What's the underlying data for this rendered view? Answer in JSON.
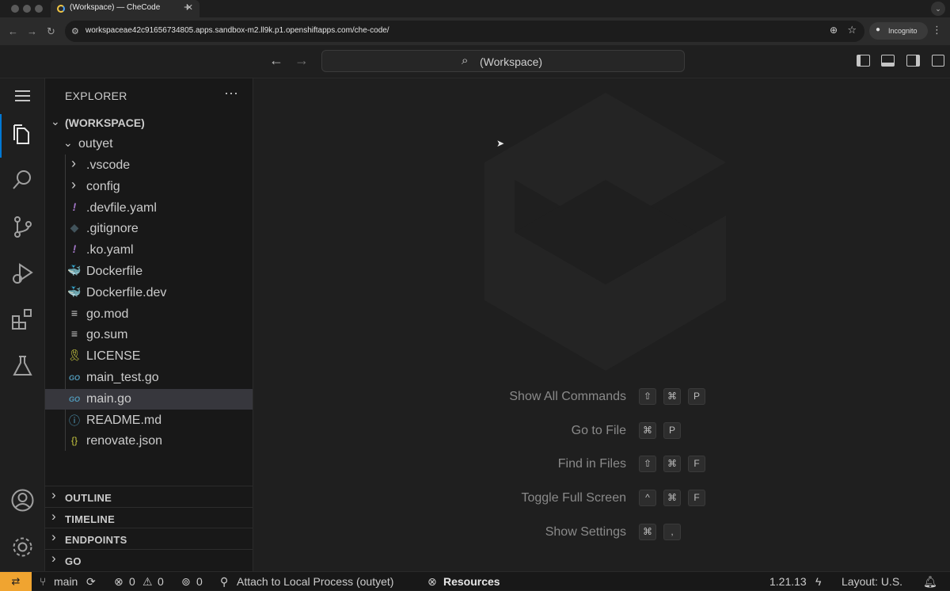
{
  "browser": {
    "tab_title": "(Workspace) — CheCode",
    "tab_close": "✕",
    "new_tab": "+",
    "url": "workspaceae42c91656734805.apps.sandbox-m2.ll9k.p1.openshiftapps.com/che-code/",
    "incognito_label": "Incognito"
  },
  "titlebar": {
    "command_center": "(Workspace)"
  },
  "explorer": {
    "title": "EXPLORER",
    "more": "···",
    "root": "(WORKSPACE)",
    "folder": "outyet",
    "items": [
      {
        "name": ".vscode",
        "type": "folder",
        "icon": "chevron-right-icon"
      },
      {
        "name": "config",
        "type": "folder",
        "icon": "chevron-right-icon"
      },
      {
        "name": ".devfile.yaml",
        "type": "file",
        "icon": "yaml-icon",
        "glyph": "!",
        "color": "#a074c4"
      },
      {
        "name": ".gitignore",
        "type": "file",
        "icon": "git-icon",
        "glyph": "◆",
        "color": "#41535b"
      },
      {
        "name": ".ko.yaml",
        "type": "file",
        "icon": "yaml-icon",
        "glyph": "!",
        "color": "#a074c4"
      },
      {
        "name": "Dockerfile",
        "type": "file",
        "icon": "docker-icon",
        "glyph": "🐳",
        "color": "#519aba"
      },
      {
        "name": "Dockerfile.dev",
        "type": "file",
        "icon": "docker-icon",
        "glyph": "🐳",
        "color": "#519aba"
      },
      {
        "name": "go.mod",
        "type": "file",
        "icon": "lines-icon",
        "glyph": "≡",
        "color": "#cccccc"
      },
      {
        "name": "go.sum",
        "type": "file",
        "icon": "lines-icon",
        "glyph": "≡",
        "color": "#cccccc"
      },
      {
        "name": "LICENSE",
        "type": "file",
        "icon": "license-icon",
        "glyph": "🎗",
        "color": "#cbcb41"
      },
      {
        "name": "main_test.go",
        "type": "file",
        "icon": "go-icon",
        "glyph": "GO",
        "color": "#519aba"
      },
      {
        "name": "main.go",
        "type": "file",
        "icon": "go-icon",
        "glyph": "GO",
        "color": "#519aba",
        "selected": true
      },
      {
        "name": "README.md",
        "type": "file",
        "icon": "info-icon",
        "glyph": "ⓘ",
        "color": "#519aba"
      },
      {
        "name": "renovate.json",
        "type": "file",
        "icon": "json-icon",
        "glyph": "{}",
        "color": "#cbcb41"
      }
    ],
    "sections": [
      "OUTLINE",
      "TIMELINE",
      "ENDPOINTS",
      "GO"
    ]
  },
  "shortcuts": [
    {
      "label": "Show All Commands",
      "keys": [
        "⇧",
        "⌘",
        "P"
      ]
    },
    {
      "label": "Go to File",
      "keys": [
        "⌘",
        "P"
      ]
    },
    {
      "label": "Find in Files",
      "keys": [
        "⇧",
        "⌘",
        "F"
      ]
    },
    {
      "label": "Toggle Full Screen",
      "keys": [
        "^",
        "⌘",
        "F"
      ]
    },
    {
      "label": "Show Settings",
      "keys": [
        "⌘",
        ","
      ]
    }
  ],
  "statusbar": {
    "branch": "main",
    "errors": "0",
    "warnings": "0",
    "ports": "0",
    "attach": "Attach to Local Process (outyet)",
    "resources": "Resources",
    "go_version": "1.21.13",
    "layout": "Layout: U.S."
  },
  "colors": {
    "accent": "#0078d4",
    "remote": "#f0a430"
  }
}
